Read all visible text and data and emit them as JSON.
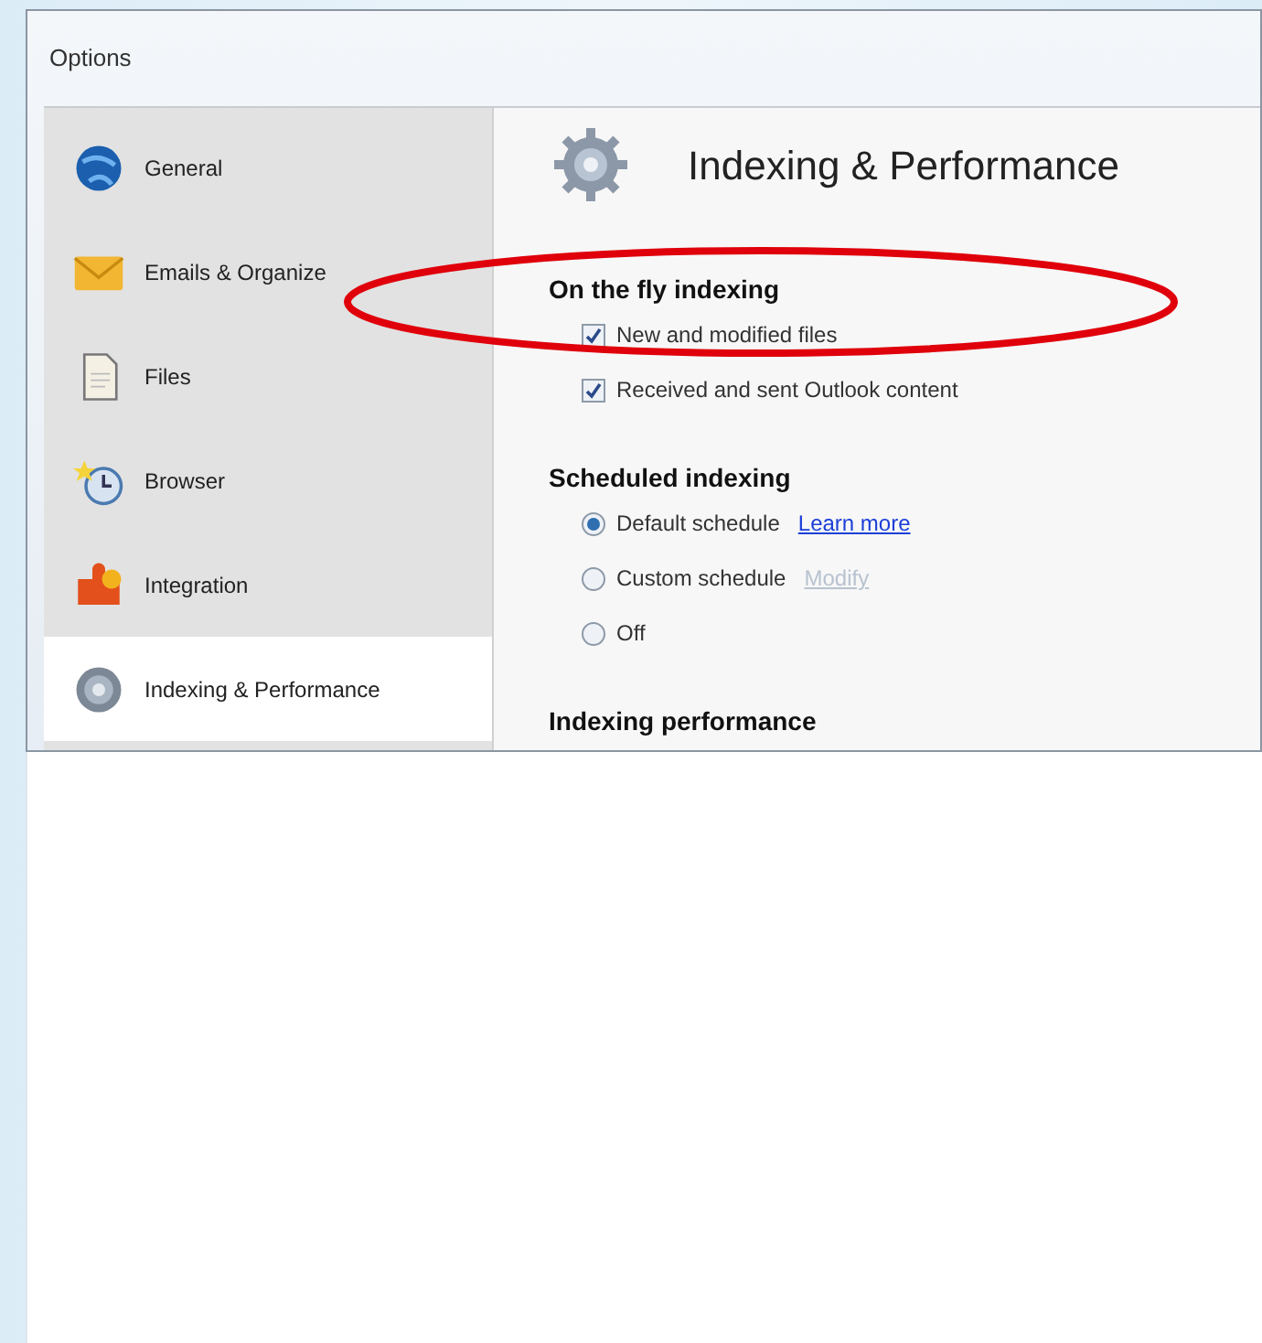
{
  "window": {
    "title": "Options"
  },
  "sidebar": {
    "items": [
      {
        "label": "General",
        "selected": false
      },
      {
        "label": "Emails & Organize",
        "selected": false
      },
      {
        "label": "Files",
        "selected": false
      },
      {
        "label": "Browser",
        "selected": false
      },
      {
        "label": "Integration",
        "selected": false
      },
      {
        "label": "Indexing & Performance",
        "selected": true
      }
    ]
  },
  "panel": {
    "title": "Indexing & Performance",
    "sections": [
      {
        "heading": "On the fly indexing",
        "options": [
          {
            "kind": "checkbox",
            "label": "New and modified files",
            "checked": true
          },
          {
            "kind": "checkbox",
            "label": "Received and sent Outlook content",
            "checked": true
          }
        ]
      },
      {
        "heading": "Scheduled indexing",
        "options": [
          {
            "kind": "radio",
            "label": "Default schedule",
            "selected": true,
            "link": "Learn more",
            "link_disabled": false
          },
          {
            "kind": "radio",
            "label": "Custom schedule",
            "selected": false,
            "link": "Modify",
            "link_disabled": true
          },
          {
            "kind": "radio",
            "label": "Off",
            "selected": false
          }
        ]
      },
      {
        "heading": "Indexing performance"
      }
    ]
  }
}
